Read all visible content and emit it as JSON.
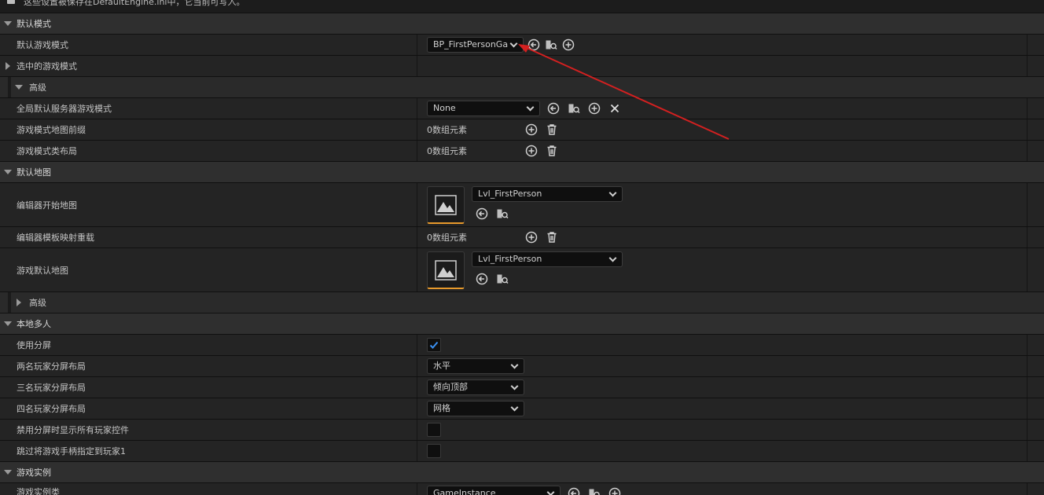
{
  "header": {
    "notice": "这些设置被保存在DefaultEngine.ini中，它当前可写入。"
  },
  "sections": {
    "default_modes": {
      "title": "默认模式",
      "default_game_mode": {
        "label": "默认游戏模式",
        "value": "BP_FirstPersonGa"
      },
      "selected_game_mode": {
        "label": "选中的游戏模式"
      },
      "advanced": {
        "title": "高级",
        "global_server_mode": {
          "label": "全局默认服务器游戏模式",
          "value": "None"
        },
        "map_prefixes": {
          "label": "游戏模式地图前缀",
          "value": "0数组元素"
        },
        "class_aliases": {
          "label": "游戏模式类布局",
          "value": "0数组元素"
        }
      }
    },
    "default_maps": {
      "title": "默认地图",
      "editor_startup_map": {
        "label": "编辑器开始地图",
        "value": "Lvl_FirstPerson"
      },
      "editor_template_overrides": {
        "label": "编辑器模板映射重载",
        "value": "0数组元素"
      },
      "game_default_map": {
        "label": "游戏默认地图",
        "value": "Lvl_FirstPerson"
      },
      "advanced": {
        "title": "高级"
      }
    },
    "local_multiplayer": {
      "title": "本地多人",
      "use_splitscreen": {
        "label": "使用分屏",
        "checked": true
      },
      "two_player_layout": {
        "label": "两名玩家分屏布局",
        "value": "水平"
      },
      "three_player_layout": {
        "label": "三名玩家分屏布局",
        "value": "倾向顶部"
      },
      "four_player_layout": {
        "label": "四名玩家分屏布局",
        "value": "网格"
      },
      "disable_all_widgets": {
        "label": "禁用分屏时显示所有玩家控件",
        "checked": false
      },
      "skip_gamepad_player1": {
        "label": "跳过将游戏手柄指定到玩家1",
        "checked": false
      }
    },
    "game_instance": {
      "title": "游戏实例",
      "game_instance_class": {
        "label": "游戏实例类",
        "value": "GameInstance"
      }
    }
  },
  "colors": {
    "accent": "#e89a2c",
    "check": "#3a8ff0",
    "annotation_arrow": "#d42020"
  },
  "icons": [
    "browse-back-icon",
    "browse-asset-icon",
    "add-icon",
    "clear-icon",
    "delete-icon",
    "map-thumbnail-icon",
    "checkmark-icon"
  ]
}
